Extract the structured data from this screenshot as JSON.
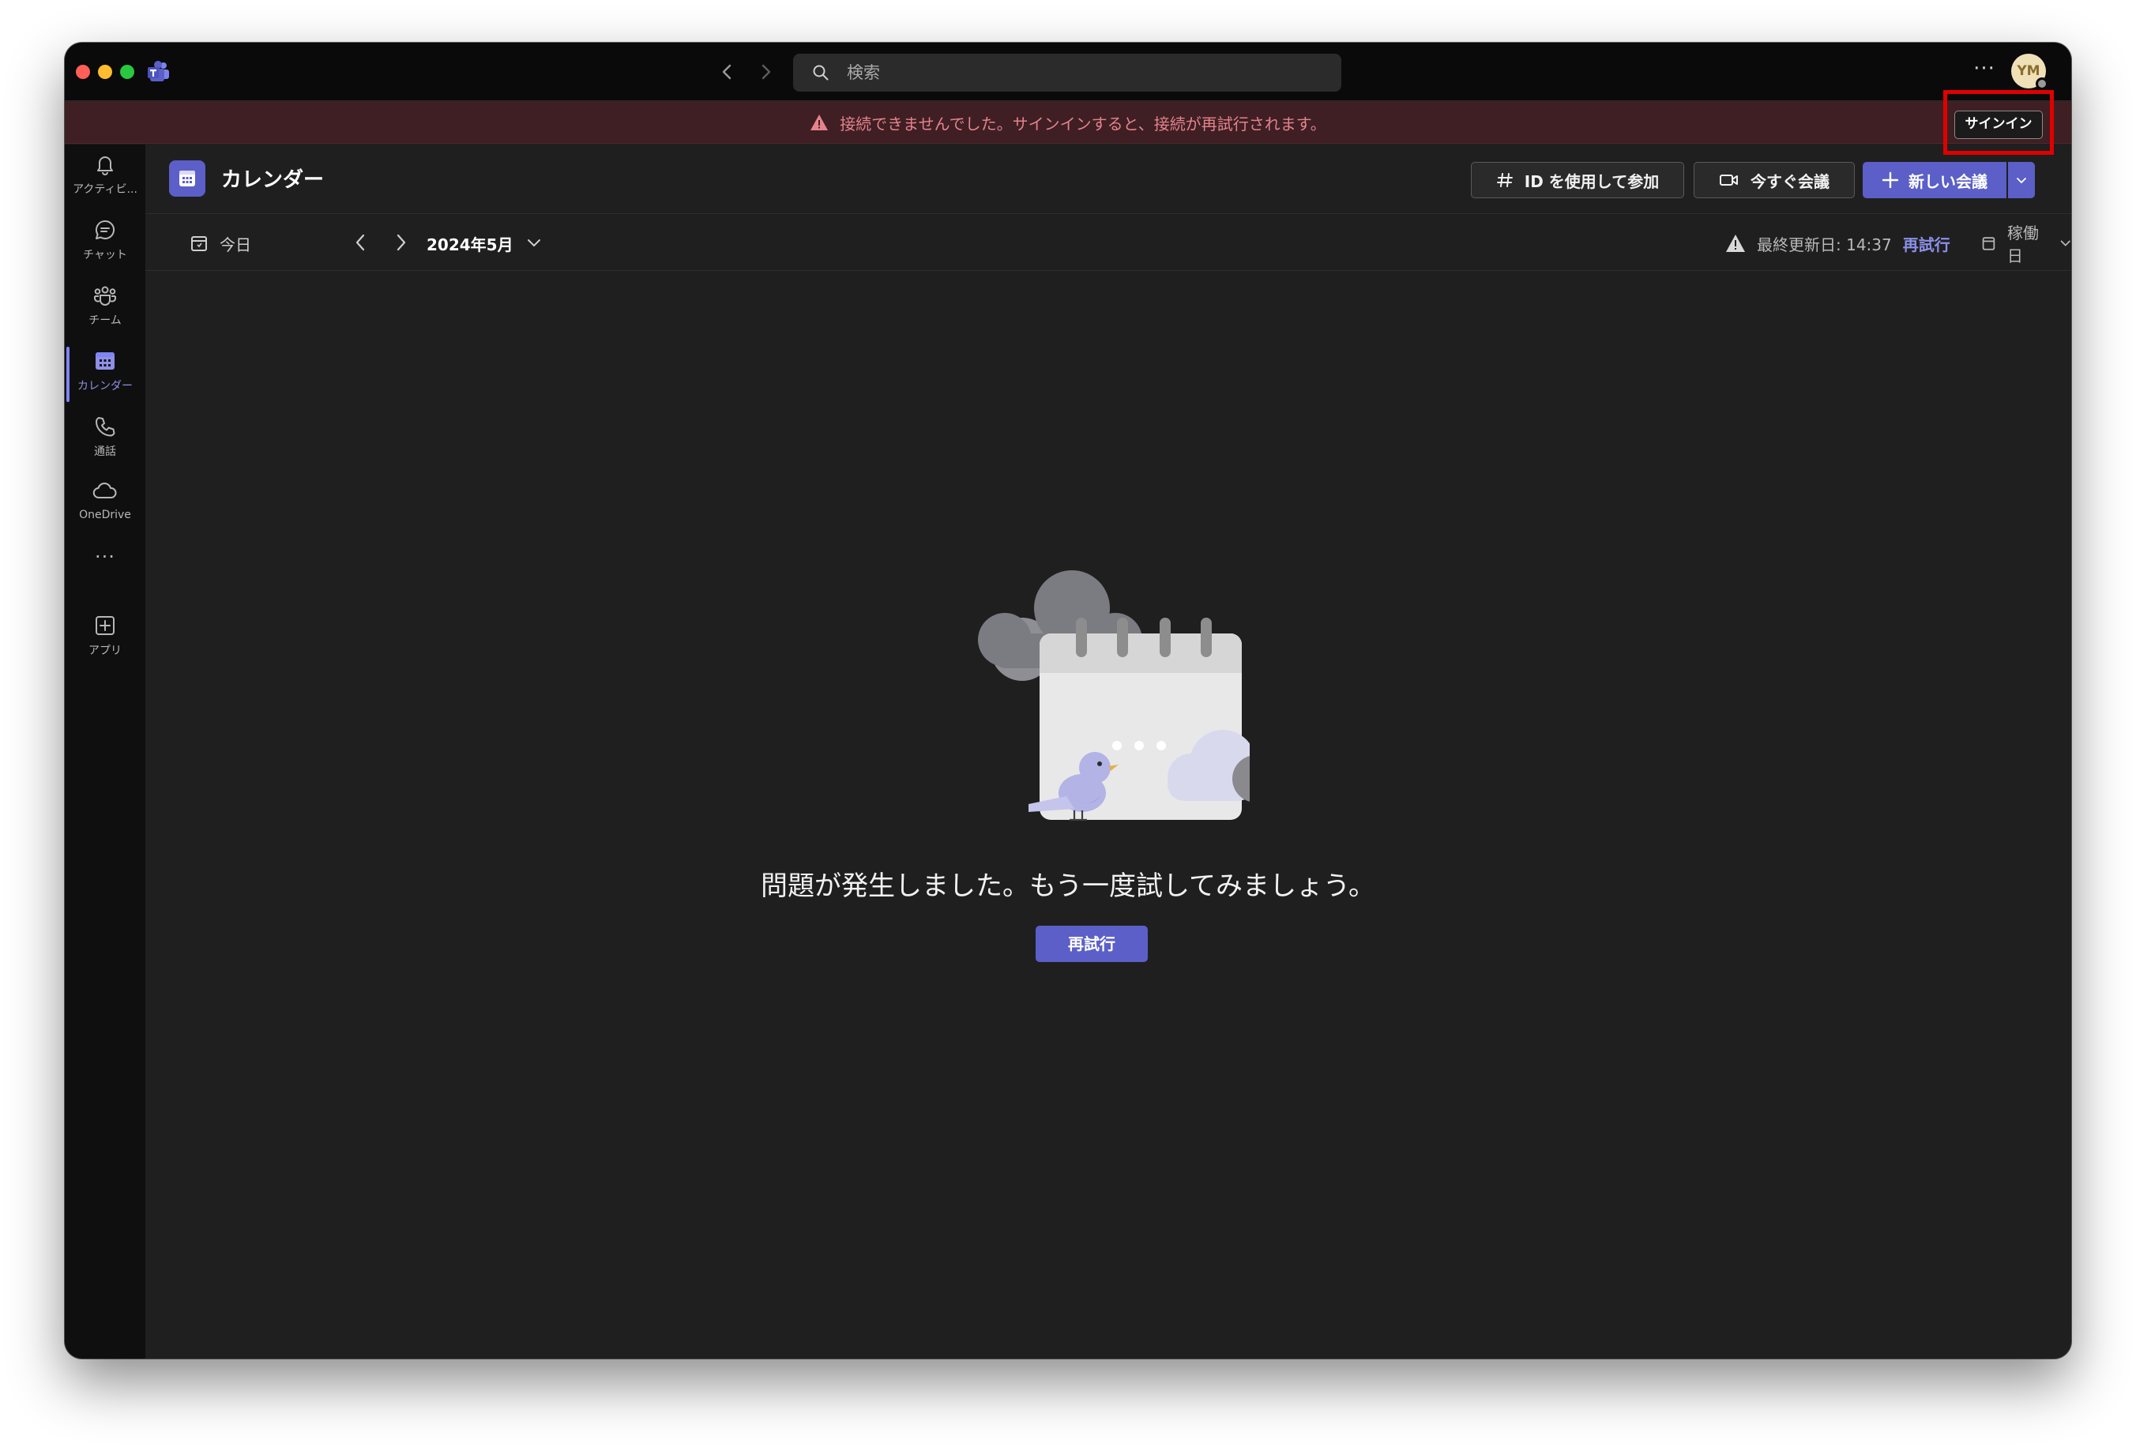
{
  "titlebar": {
    "search_placeholder": "検索",
    "more_label": "···",
    "avatar_initials": "YM"
  },
  "banner": {
    "message": "接続できませんでした。サインインすると、接続が再試行されます。",
    "signin_label": "サインイン"
  },
  "rail": {
    "items": [
      {
        "label": "アクティビ...",
        "icon": "bell-icon"
      },
      {
        "label": "チャット",
        "icon": "chat-icon"
      },
      {
        "label": "チーム",
        "icon": "teams-icon"
      },
      {
        "label": "カレンダー",
        "icon": "calendar-icon",
        "active": true
      },
      {
        "label": "通話",
        "icon": "phone-icon"
      },
      {
        "label": "OneDrive",
        "icon": "cloud-icon"
      },
      {
        "label": "···",
        "icon": "more-icon"
      },
      {
        "label": "アプリ",
        "icon": "add-app-icon"
      }
    ]
  },
  "header": {
    "title": "カレンダー",
    "join_label": "ID を使用して参加",
    "meet_now_label": "今すぐ会議",
    "new_meeting_label": "新しい会議"
  },
  "toolbar": {
    "today_label": "今日",
    "month_label": "2024年5月",
    "last_updated": "最終更新日: 14:37",
    "retry_link": "再試行",
    "view_label": "稼働日"
  },
  "empty_state": {
    "message": "問題が発生しました。もう一度試してみましょう。",
    "retry_label": "再試行"
  },
  "colors": {
    "accent": "#5b5fc7",
    "error_text": "#e4838e",
    "banner_bg": "#3f1f23",
    "highlight": "#e00000"
  }
}
